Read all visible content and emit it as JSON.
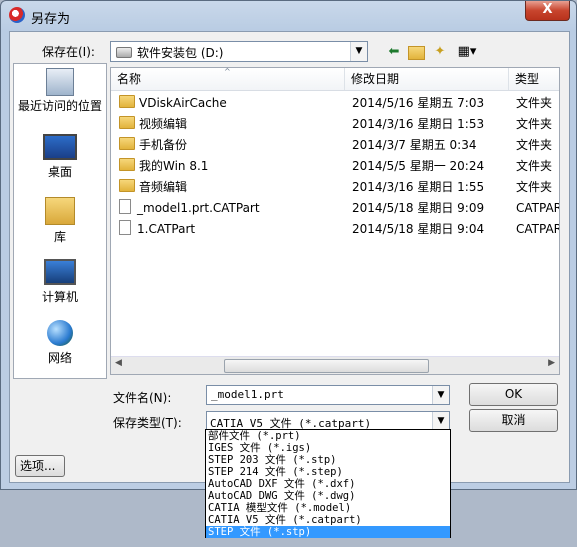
{
  "window": {
    "title": "另存为",
    "close_label": "X"
  },
  "save_in": {
    "label": "保存在(I):",
    "value": "软件安装包 (D:)"
  },
  "places": [
    {
      "label": "最近访问的位置",
      "icon": "recent-places-icon"
    },
    {
      "label": "桌面",
      "icon": "desktop-icon"
    },
    {
      "label": "库",
      "icon": "libraries-icon"
    },
    {
      "label": "计算机",
      "icon": "computer-icon"
    },
    {
      "label": "网络",
      "icon": "network-icon"
    }
  ],
  "columns": {
    "name": "名称",
    "date": "修改日期",
    "type": "类型"
  },
  "files": [
    {
      "name": "VDiskAirCache",
      "date": "2014/5/16 星期五 7:03",
      "type": "文件夹",
      "kind": "folder"
    },
    {
      "name": "视频编辑",
      "date": "2014/3/16 星期日 1:53",
      "type": "文件夹",
      "kind": "folder"
    },
    {
      "name": "手机备份",
      "date": "2014/3/7 星期五 0:34",
      "type": "文件夹",
      "kind": "folder"
    },
    {
      "name": "我的Win 8.1",
      "date": "2014/5/5 星期一 20:24",
      "type": "文件夹",
      "kind": "folder"
    },
    {
      "name": "音频编辑",
      "date": "2014/3/16 星期日 1:55",
      "type": "文件夹",
      "kind": "folder"
    },
    {
      "name": "_model1.prt.CATPart",
      "date": "2014/5/18 星期日 9:09",
      "type": "CATPAR",
      "kind": "file"
    },
    {
      "name": "1.CATPart",
      "date": "2014/5/18 星期日 9:04",
      "type": "CATPAR",
      "kind": "file"
    }
  ],
  "filename": {
    "label": "文件名(N):",
    "value": "_model1.prt"
  },
  "filetype": {
    "label": "保存类型(T):",
    "value": "CATIA V5 文件 (*.catpart)",
    "options": [
      "部件文件 (*.prt)",
      "IGES 文件 (*.igs)",
      "STEP 203 文件 (*.stp)",
      "STEP 214 文件 (*.step)",
      "AutoCAD DXF 文件 (*.dxf)",
      "AutoCAD DWG 文件 (*.dwg)",
      "CATIA 模型文件 (*.model)",
      "CATIA V5 文件 (*.catpart)",
      "STEP 文件 (*.stp)"
    ],
    "highlighted_index": 8
  },
  "buttons": {
    "ok": "OK",
    "cancel": "取消",
    "options": "选项..."
  },
  "colors": {
    "highlight": "#3399ff",
    "close": "#c8452e"
  }
}
